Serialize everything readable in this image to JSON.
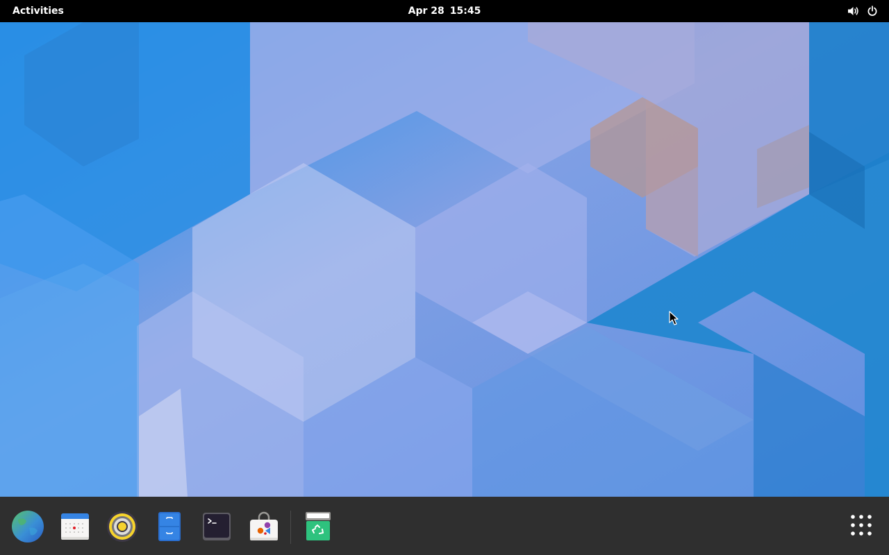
{
  "topbar": {
    "activities_label": "Activities",
    "clock_date": "Apr 28",
    "clock_time": "15:45",
    "volume_icon": "volume-icon",
    "power_icon": "power-icon"
  },
  "dock": {
    "apps": [
      {
        "id": "web-browser",
        "icon": "globe-icon"
      },
      {
        "id": "calendar",
        "icon": "calendar-icon"
      },
      {
        "id": "rhythmbox",
        "icon": "speaker-icon"
      },
      {
        "id": "file-manager",
        "icon": "file-cabinet-icon"
      },
      {
        "id": "terminal",
        "icon": "terminal-icon"
      },
      {
        "id": "software",
        "icon": "shopping-bag-icon"
      }
    ],
    "trash_icon": "trash-icon",
    "show_apps_icon": "grid-icon"
  },
  "colors": {
    "topbar": "#000000",
    "dock": "#2f2f2f",
    "wallpaper_base": "#6f9be3",
    "wallpaper_blue": "#1e86d6",
    "wallpaper_lavender": "#a7b4ea",
    "wallpaper_peach": "#b89a9b"
  }
}
